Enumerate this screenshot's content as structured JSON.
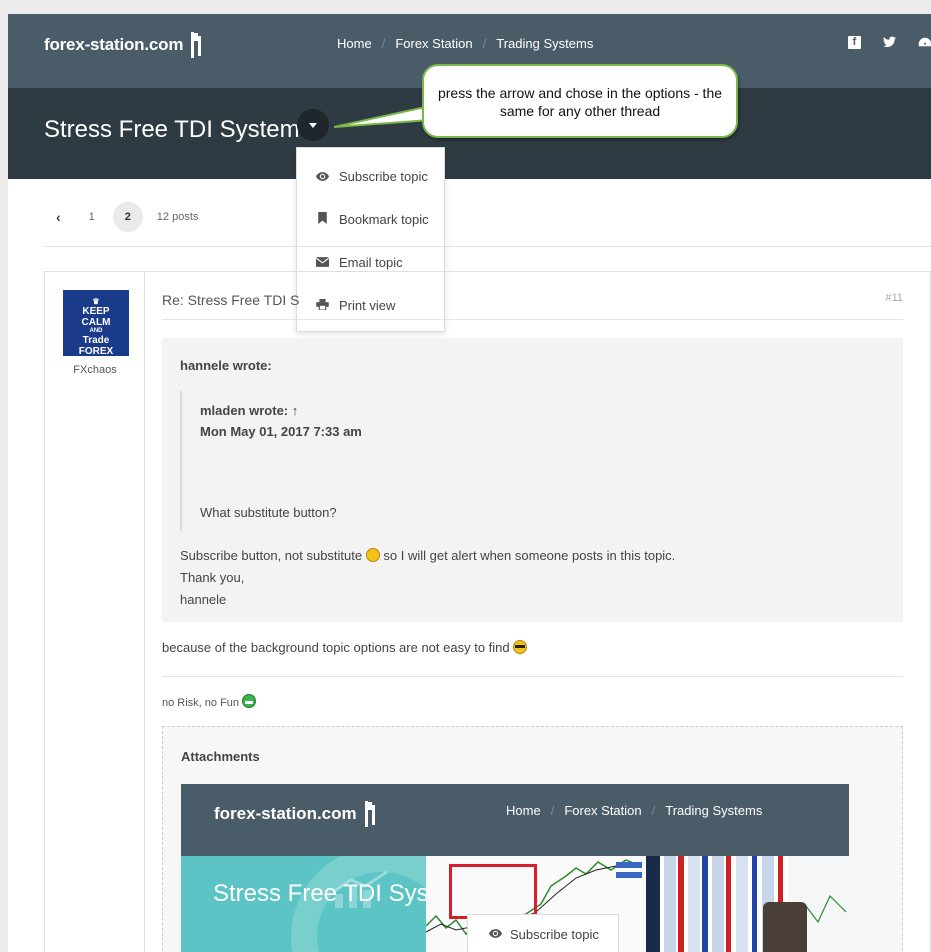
{
  "header": {
    "logo": "forex-station.com",
    "nav": [
      "Home",
      "Forex Station",
      "Trading Systems"
    ],
    "social_icons": [
      "facebook-icon",
      "twitter-icon",
      "dashboard-icon"
    ]
  },
  "topic": {
    "title": "Stress Free TDI System"
  },
  "callout": {
    "text": "press the arrow and chose in the options - the same for any other thread"
  },
  "dropdown": {
    "items": [
      {
        "label": "Subscribe topic",
        "icon": "eye-icon"
      },
      {
        "label": "Bookmark topic",
        "icon": "bookmark-icon"
      },
      {
        "label": "Email topic",
        "icon": "envelope-icon"
      },
      {
        "label": "Print view",
        "icon": "print-icon"
      }
    ]
  },
  "pagination": {
    "pages": [
      "1",
      "2"
    ],
    "active": "2",
    "post_count": "12 posts"
  },
  "post": {
    "author": "FXchaos",
    "avatar_text": [
      "KEEP",
      "CALM",
      "AND",
      "Trade",
      "FOREX"
    ],
    "subject": "Re: Stress Free TDI S",
    "number": "#11",
    "quote": {
      "author": "hannele wrote:",
      "nested_author": "mladen wrote: ↑",
      "nested_date": "Mon May 01, 2017 7:33 am",
      "nested_text": "What substitute button?",
      "text_line1": "Subscribe button, not substitute",
      "text_line1b": "so I will get alert when someone posts in this topic.",
      "text_line2": "Thank you,",
      "text_line3": "hannele"
    },
    "body_text": "because of the background topic options are not easy to find",
    "signature": "no Risk, no Fun",
    "attachments_title": "Attachments"
  },
  "screenshot": {
    "logo": "forex-station.com",
    "nav": [
      "Home",
      "Forex Station",
      "Trading Systems"
    ],
    "title": "Stress Free TDI Syst",
    "dropdown_label": "Subscribe topic"
  },
  "colors": {
    "navbar": "#4a5c68",
    "titlebar": "#2f3b42",
    "callout_border": "#7bb84a",
    "highlight_red": "#d81e2c"
  }
}
